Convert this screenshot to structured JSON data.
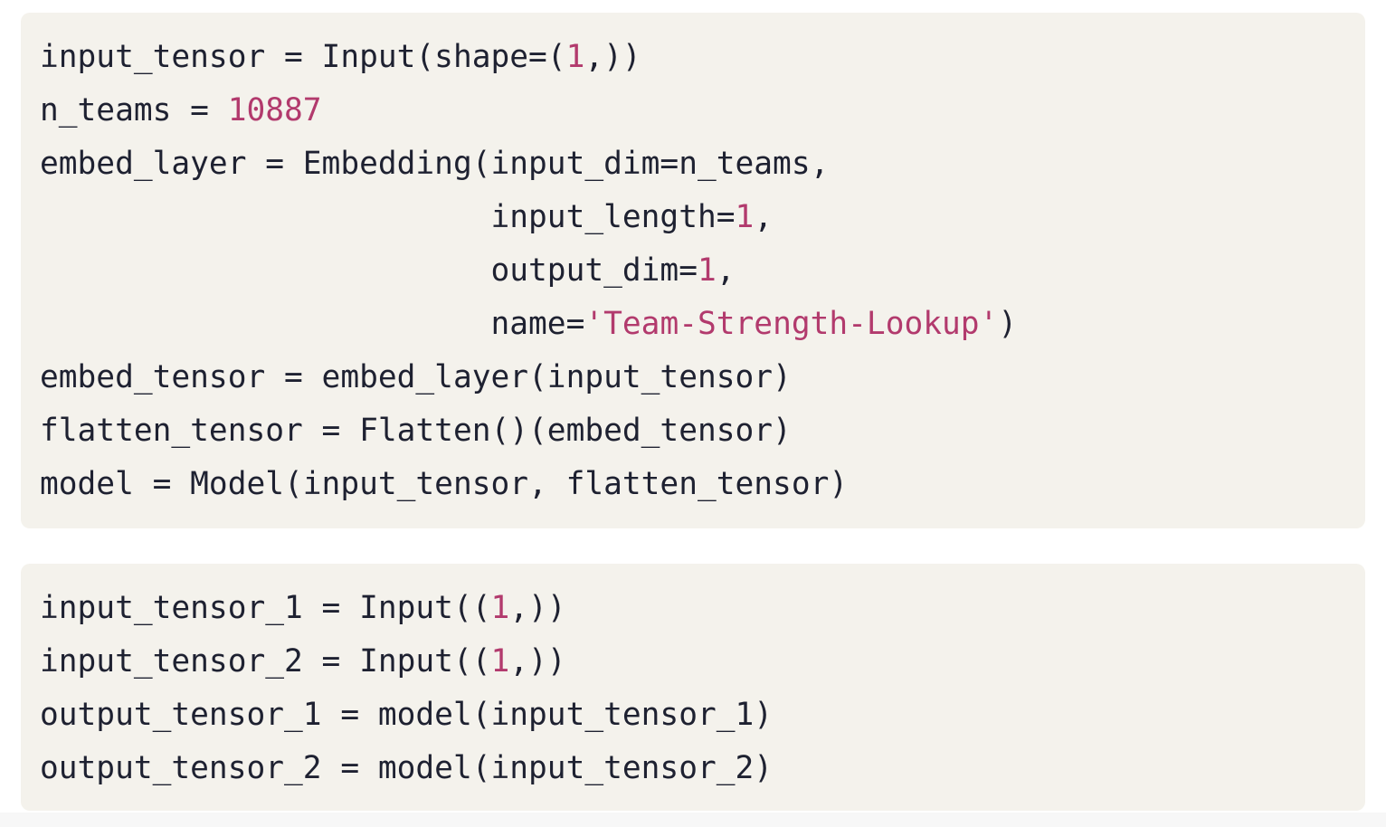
{
  "colors": {
    "background": "#ffffff",
    "code_background": "#f4f2ec",
    "text": "#1e2131",
    "literal": "#b23a6d"
  },
  "code_blocks": [
    {
      "lines": [
        [
          {
            "text": "input_tensor = Input(shape=(",
            "kind": "plain"
          },
          {
            "text": "1",
            "kind": "number"
          },
          {
            "text": ",))",
            "kind": "plain"
          }
        ],
        [
          {
            "text": "n_teams = ",
            "kind": "plain"
          },
          {
            "text": "10887",
            "kind": "number"
          }
        ],
        [
          {
            "text": "embed_layer = Embedding(input_dim=n_teams,",
            "kind": "plain"
          }
        ],
        [
          {
            "text": "                        input_length=",
            "kind": "plain"
          },
          {
            "text": "1",
            "kind": "number"
          },
          {
            "text": ",",
            "kind": "plain"
          }
        ],
        [
          {
            "text": "                        output_dim=",
            "kind": "plain"
          },
          {
            "text": "1",
            "kind": "number"
          },
          {
            "text": ",",
            "kind": "plain"
          }
        ],
        [
          {
            "text": "                        name=",
            "kind": "plain"
          },
          {
            "text": "'Team-Strength-Lookup'",
            "kind": "string"
          },
          {
            "text": ")",
            "kind": "plain"
          }
        ],
        [
          {
            "text": "embed_tensor = embed_layer(input_tensor)",
            "kind": "plain"
          }
        ],
        [
          {
            "text": "flatten_tensor = Flatten()(embed_tensor)",
            "kind": "plain"
          }
        ],
        [
          {
            "text": "model = Model(input_tensor, flatten_tensor)",
            "kind": "plain"
          }
        ]
      ]
    },
    {
      "lines": [
        [
          {
            "text": "input_tensor_1 = Input((",
            "kind": "plain"
          },
          {
            "text": "1",
            "kind": "number"
          },
          {
            "text": ",))",
            "kind": "plain"
          }
        ],
        [
          {
            "text": "input_tensor_2 = Input((",
            "kind": "plain"
          },
          {
            "text": "1",
            "kind": "number"
          },
          {
            "text": ",))",
            "kind": "plain"
          }
        ],
        [
          {
            "text": "output_tensor_1 = model(input_tensor_1)",
            "kind": "plain"
          }
        ],
        [
          {
            "text": "output_tensor_2 = model(input_tensor_2)",
            "kind": "plain"
          }
        ]
      ]
    }
  ]
}
